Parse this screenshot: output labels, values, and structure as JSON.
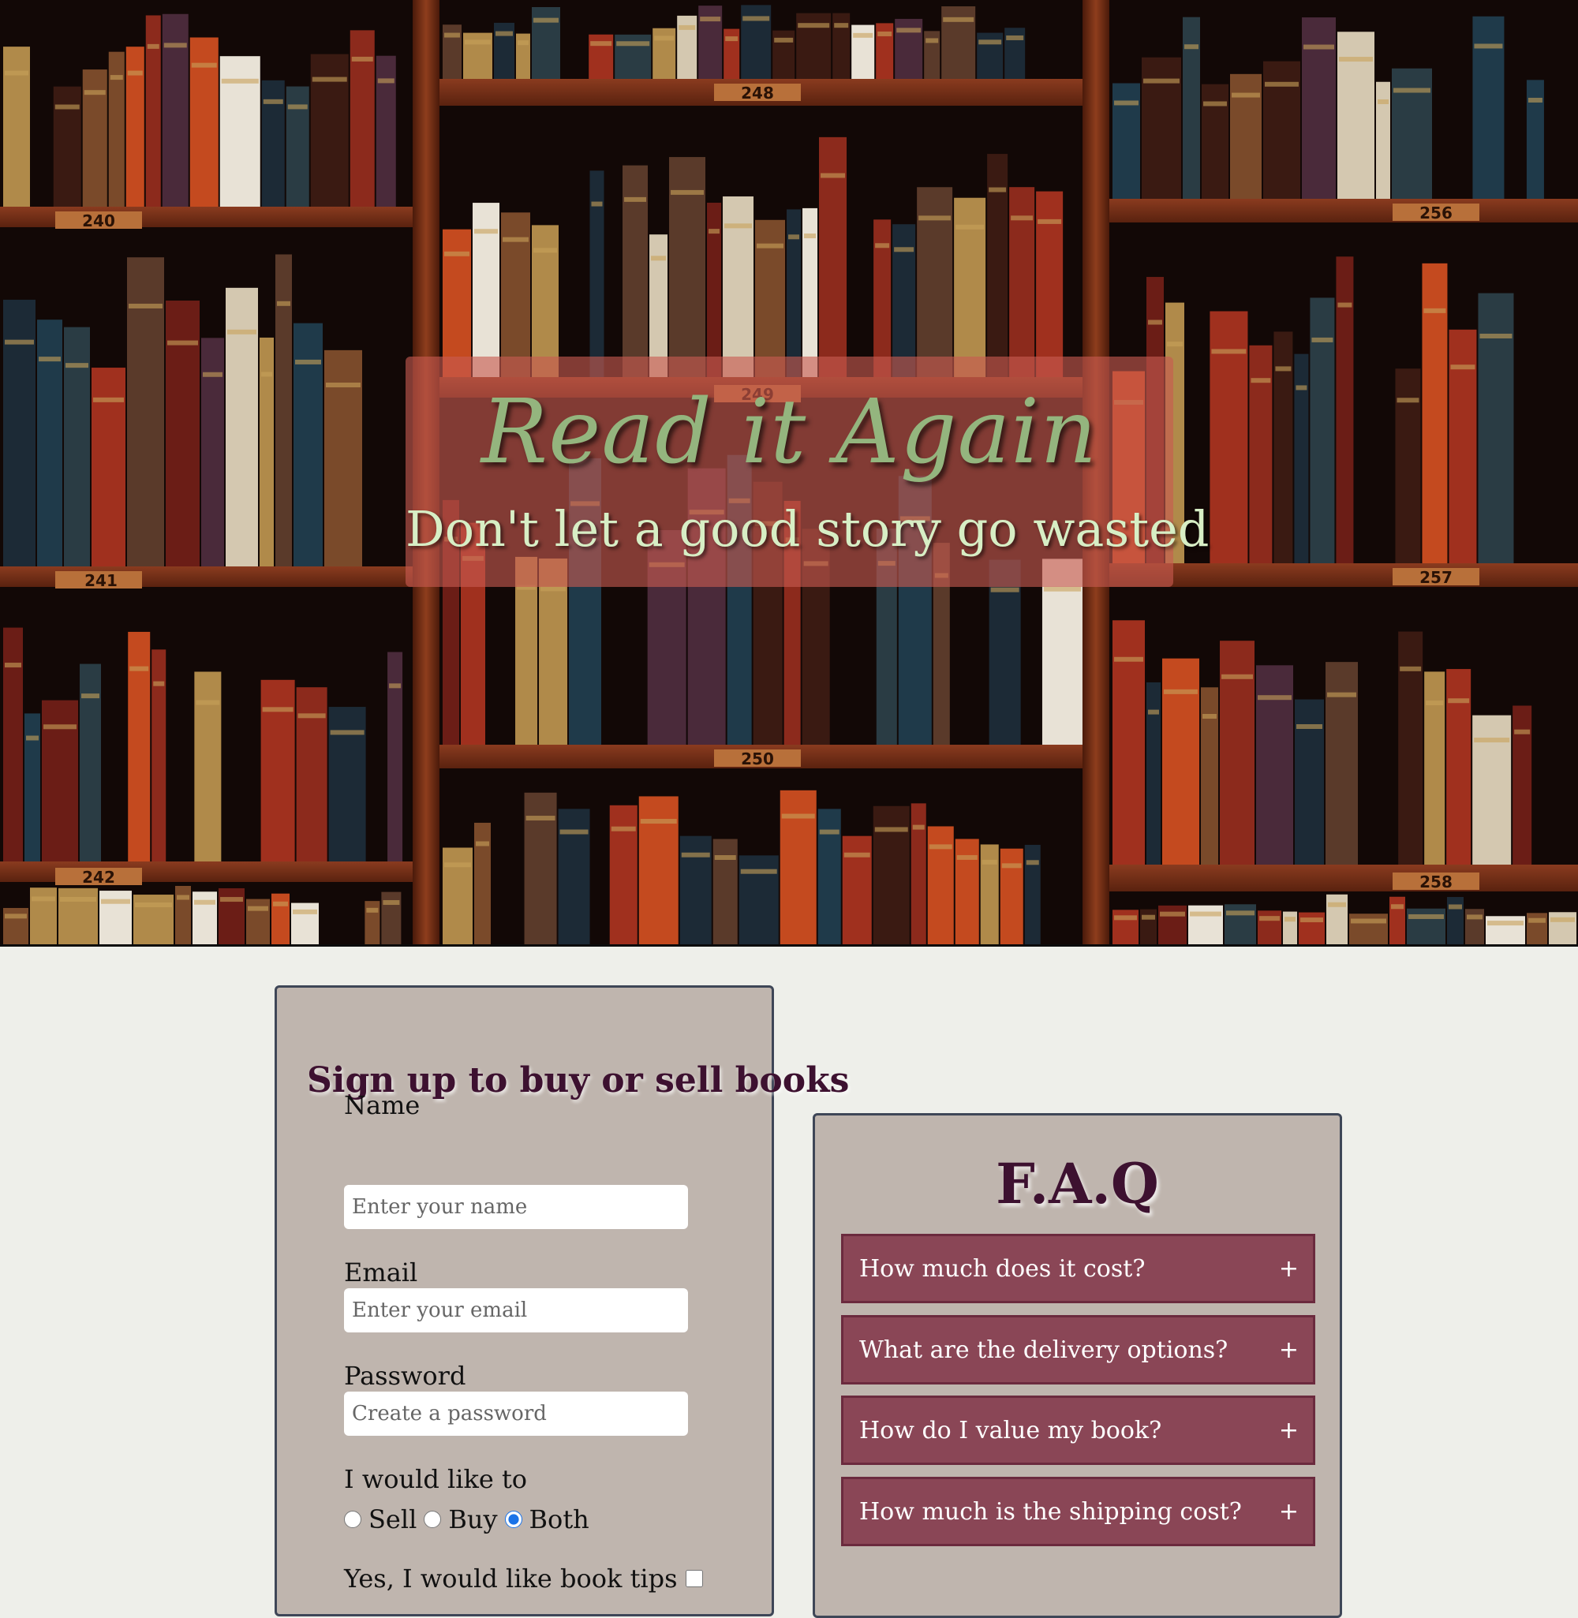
{
  "hero": {
    "title": "Read it Again",
    "subtitle": "Don't let a good story go wasted",
    "shelf_labels": [
      "240",
      "241",
      "242",
      "248",
      "249",
      "250",
      "256",
      "257",
      "258"
    ]
  },
  "signup": {
    "heading": "Sign up to buy or sell books",
    "name": {
      "label": "Name",
      "placeholder": "Enter your name"
    },
    "email": {
      "label": "Email",
      "placeholder": "Enter your email"
    },
    "password": {
      "label": "Password",
      "placeholder": "Create a password"
    },
    "preference_label": "I would like to",
    "options": [
      {
        "label": "Sell",
        "selected": false
      },
      {
        "label": "Buy",
        "selected": false
      },
      {
        "label": "Both",
        "selected": true
      }
    ],
    "tips_label": "Yes, I would like book tips"
  },
  "faq": {
    "heading": "F.A.Q",
    "toggle_symbol": "+",
    "items": [
      {
        "question": "How much does it cost?"
      },
      {
        "question": "What are the delivery options?"
      },
      {
        "question": "How do I value my book?"
      },
      {
        "question": "How much is the shipping cost?"
      }
    ]
  },
  "colors": {
    "page_background": "#eeefea",
    "card_background": "#bfb5ae",
    "card_border": "#3e4657",
    "heading_text": "#3d1130",
    "faq_item_background": "#8a4656",
    "hero_title": "#94b57e",
    "hero_subtitle": "#d7eec5",
    "banner_overlay": "rgba(200,90,80,0.62)"
  }
}
